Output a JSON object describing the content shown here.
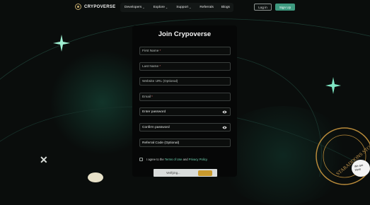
{
  "brand": {
    "name": "CRYPOVERSE"
  },
  "nav": {
    "items": [
      {
        "label": "Developers",
        "has_dropdown": true
      },
      {
        "label": "Explore",
        "has_dropdown": true
      },
      {
        "label": "Support",
        "has_dropdown": true
      },
      {
        "label": "Referrals",
        "has_dropdown": false
      },
      {
        "label": "Blogs",
        "has_dropdown": false
      }
    ],
    "login_label": "Log in",
    "signup_label": "Sign Up"
  },
  "form": {
    "title": "Join Crypoverse",
    "fields": [
      {
        "label": "First Name",
        "required": true,
        "type": "text"
      },
      {
        "label": "Last Name",
        "required": true,
        "type": "text"
      },
      {
        "label": "Website URL (Optional)",
        "required": false,
        "type": "url"
      },
      {
        "label": "Email",
        "required": true,
        "type": "email"
      },
      {
        "label": "Enter password",
        "required": false,
        "type": "password"
      },
      {
        "label": "Confirm password",
        "required": false,
        "type": "password"
      },
      {
        "label": "Referral Code (Optional)",
        "required": false,
        "type": "text"
      }
    ],
    "required_mark": "*",
    "terms": {
      "prefix": "I agree to the",
      "terms_link": "Terms of Use",
      "and": "and",
      "privacy_link": "Privacy Policy."
    },
    "captcha_label": "Verifying..."
  },
  "decor": {
    "x_glyph": "✕",
    "stamp_text": "STARADDONS STORE YOUR TRUSTED HUB",
    "help_text": "We are Here"
  },
  "colors": {
    "accent": "#3e9a80",
    "background": "#0a0d0c",
    "card": "#060707",
    "link": "#6fd2b0"
  }
}
